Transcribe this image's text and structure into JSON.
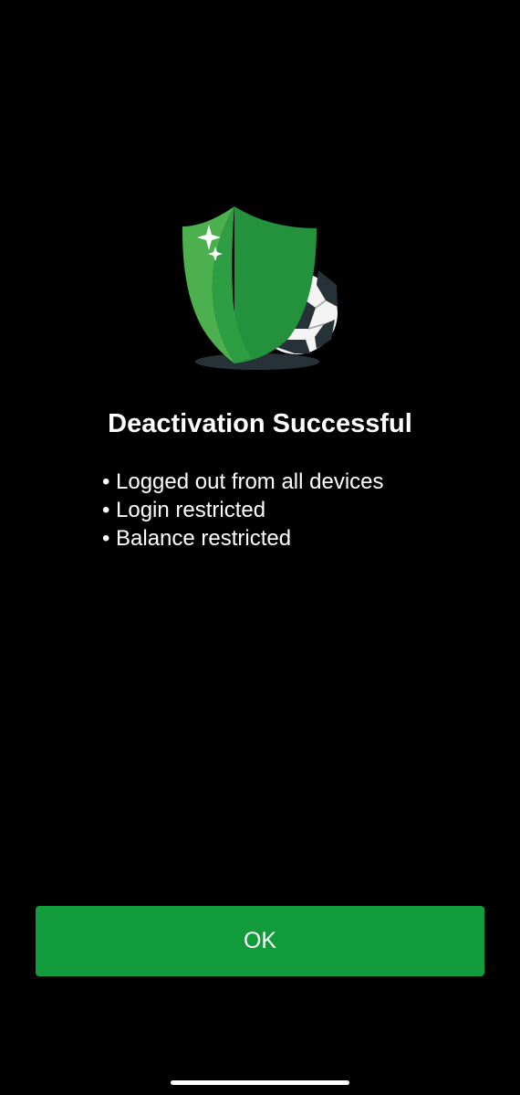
{
  "dialog": {
    "title": "Deactivation Successful",
    "bullet_symbol": "•",
    "items": [
      {
        "text": "Logged out from all devices"
      },
      {
        "text": "Login restricted"
      },
      {
        "text": "Balance restricted"
      }
    ],
    "ok_label": "OK"
  },
  "illustration": {
    "icon": "shield-with-football-icon"
  },
  "colors": {
    "background": "#000000",
    "accent": "#129b3a",
    "shield_light": "#4cb04f",
    "shield_dark": "#24913c",
    "text": "#ffffff"
  }
}
